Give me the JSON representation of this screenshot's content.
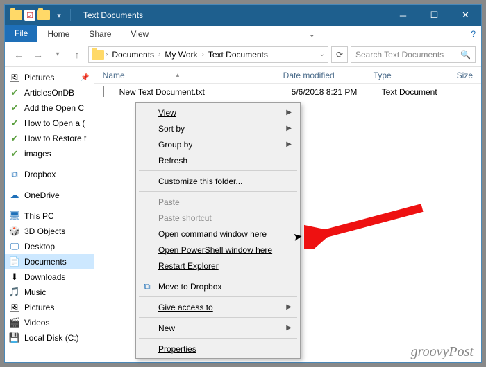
{
  "title": "Text Documents",
  "ribbon": {
    "file": "File",
    "tabs": [
      "Home",
      "Share",
      "View"
    ]
  },
  "breadcrumb": [
    "Documents",
    "My Work",
    "Text Documents"
  ],
  "search_placeholder": "Search Text Documents",
  "columns": {
    "name": "Name",
    "date": "Date modified",
    "type": "Type",
    "size": "Size"
  },
  "file": {
    "name": "New Text Document.txt",
    "date": "5/6/2018 8:21 PM",
    "type": "Text Document"
  },
  "nav": {
    "pictures": "Pictures",
    "quick": [
      "ArticlesOnDB",
      "Add the Open C",
      "How to Open a (",
      "How to Restore t",
      "images"
    ],
    "dropbox": "Dropbox",
    "onedrive": "OneDrive",
    "thispc": "This PC",
    "pc": [
      "3D Objects",
      "Desktop",
      "Documents",
      "Downloads",
      "Music",
      "Pictures",
      "Videos",
      "Local Disk (C:)"
    ]
  },
  "menu": {
    "view": "View",
    "sort": "Sort by",
    "group": "Group by",
    "refresh": "Refresh",
    "customize": "Customize this folder...",
    "paste": "Paste",
    "pastesc": "Paste shortcut",
    "cmd": "Open command window here",
    "ps": "Open PowerShell window here",
    "restart": "Restart Explorer",
    "dropbox": "Move to Dropbox",
    "give": "Give access to",
    "new": "New",
    "props": "Properties"
  },
  "watermark": "groovyPost"
}
